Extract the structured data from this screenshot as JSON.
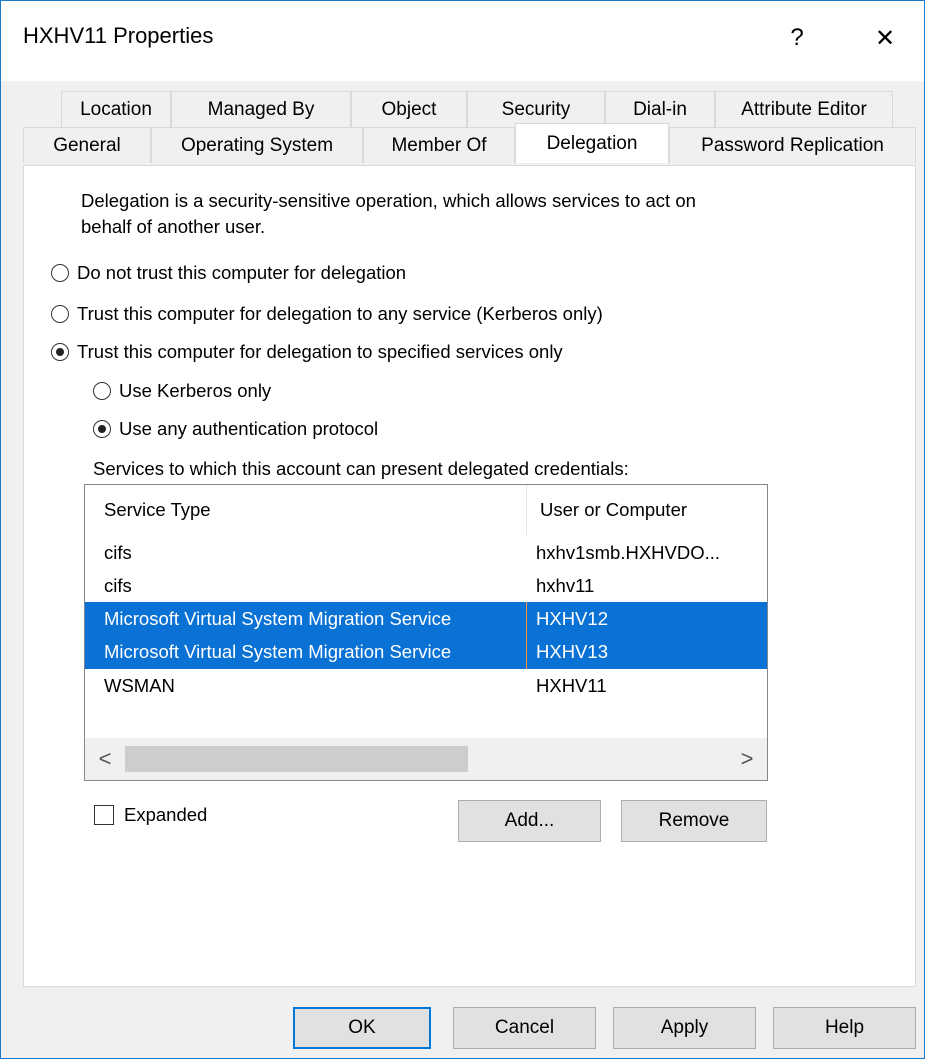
{
  "window": {
    "title": "HXHV11 Properties",
    "help_glyph": "?",
    "close_glyph": "✕"
  },
  "tabs_row1": [
    "Location",
    "Managed By",
    "Object",
    "Security",
    "Dial-in",
    "Attribute Editor"
  ],
  "tabs_row2": [
    "General",
    "Operating System",
    "Member Of",
    "Delegation",
    "Password Replication"
  ],
  "active_tab": "Delegation",
  "delegation": {
    "description_line1": "Delegation is a security-sensitive operation, which allows services to act on",
    "description_line2": "behalf of another user.",
    "options": [
      {
        "label": "Do not trust this computer for delegation",
        "selected": false
      },
      {
        "label": "Trust this computer for delegation to any service (Kerberos only)",
        "selected": false
      },
      {
        "label": "Trust this computer for delegation to specified services only",
        "selected": true
      }
    ],
    "sub_options": [
      {
        "label": "Use Kerberos only",
        "selected": false
      },
      {
        "label": "Use any authentication protocol",
        "selected": true
      }
    ],
    "services_label": "Services to which this account can present delegated credentials:",
    "columns": [
      "Service Type",
      "User or Computer"
    ],
    "rows": [
      {
        "service": "cifs",
        "target": "hxhv1smb.HXHVDO...",
        "selected": false
      },
      {
        "service": "cifs",
        "target": "hxhv11",
        "selected": false
      },
      {
        "service": "Microsoft Virtual System Migration Service",
        "target": "HXHV12",
        "selected": true
      },
      {
        "service": "Microsoft Virtual System Migration Service",
        "target": "HXHV13",
        "selected": true
      },
      {
        "service": "WSMAN",
        "target": "HXHV11",
        "selected": false
      }
    ],
    "scroll_left": "<",
    "scroll_right": ">",
    "expanded_label": "Expanded",
    "expanded_checked": false,
    "add_label": "Add...",
    "remove_label": "Remove"
  },
  "footer": {
    "ok": "OK",
    "cancel": "Cancel",
    "apply": "Apply",
    "help": "Help"
  },
  "colors": {
    "selection": "#0a72d4",
    "accent_border": "#1979ca"
  }
}
